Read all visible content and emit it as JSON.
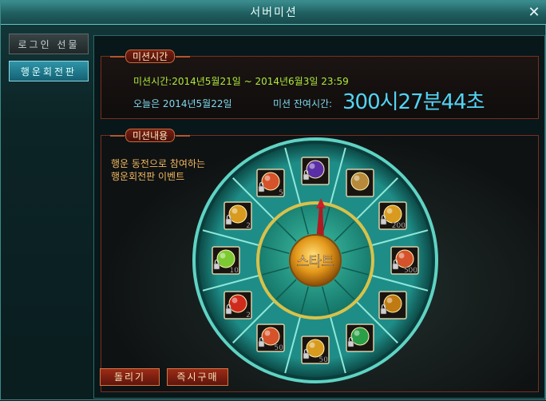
{
  "window": {
    "title": "서버미션",
    "close_label": "✕"
  },
  "sidebar": {
    "items": [
      {
        "label": "로그인 선물",
        "active": false
      },
      {
        "label": "행운회전판",
        "active": true
      }
    ]
  },
  "mission_time": {
    "tab_label": "미션시간",
    "period_label": "미션시간:2014년5월21일  ~ 2014년6월3일  23:59",
    "today_label": "오늘은 2014년5월22일",
    "remaining_label": "미션 잔여시간:",
    "remaining_value": "300시27분44초"
  },
  "mission_content": {
    "tab_label": "미션내용",
    "description_line1": "행운 동전으로 참여하는",
    "description_line2": "행운회전판 이벤트"
  },
  "wheel": {
    "center_label": "스타트",
    "slots": [
      {
        "icon": "purple-mask-icon",
        "count": "",
        "color": "#5a2fa6",
        "locked": true
      },
      {
        "icon": "chain-whip-icon",
        "count": "",
        "color": "#b68a3a",
        "locked": false
      },
      {
        "icon": "gold-coin-bag-icon",
        "count": "200",
        "color": "#d89b1f",
        "locked": true
      },
      {
        "icon": "red-scroll-icon",
        "count": "500",
        "color": "#d5522a",
        "locked": true
      },
      {
        "icon": "gold-rune-icon",
        "count": "",
        "color": "#c07a12",
        "locked": true
      },
      {
        "icon": "green-orb-icon",
        "count": "",
        "color": "#2a9f48",
        "locked": true
      },
      {
        "icon": "gold-coin-bag-icon",
        "count": "50",
        "color": "#d89b1f",
        "locked": true
      },
      {
        "icon": "red-scroll-icon",
        "count": "50",
        "color": "#d5522a",
        "locked": true
      },
      {
        "icon": "red-orb-icon",
        "count": "2",
        "color": "#cf2b1d",
        "locked": true
      },
      {
        "icon": "green-potion-icon",
        "count": "10",
        "color": "#7cc932",
        "locked": true
      },
      {
        "icon": "gold-coin-bag-icon",
        "count": "2",
        "color": "#d89b1f",
        "locked": true
      },
      {
        "icon": "red-scroll-icon",
        "count": "5",
        "color": "#d5522a",
        "locked": true
      }
    ]
  },
  "buttons": {
    "spin_label": "돌리기",
    "buy_label": "즉시구매"
  },
  "colors": {
    "accent_teal": "#3fbfb5",
    "time_cyan": "#52d4f4",
    "text_green": "#aeea3a",
    "button_red": "#9d2b17"
  }
}
